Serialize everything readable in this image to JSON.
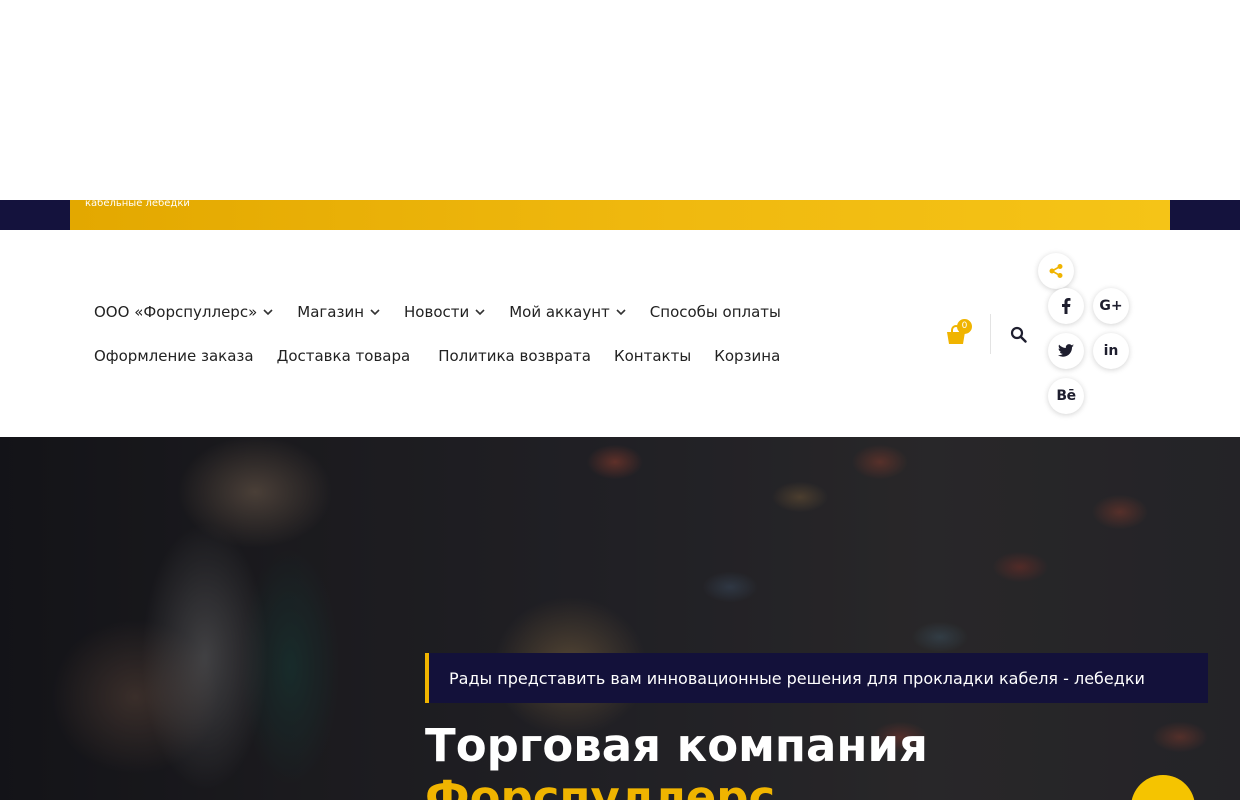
{
  "topbar": {
    "tagline": "кабельные лебедки"
  },
  "nav": {
    "row1": [
      {
        "label": "ООО «Форспуллерс»",
        "dropdown": true
      },
      {
        "label": "Магазин",
        "dropdown": true
      },
      {
        "label": "Новости",
        "dropdown": true
      },
      {
        "label": "Мой аккаунт",
        "dropdown": true
      },
      {
        "label": "Способы оплаты",
        "dropdown": false
      }
    ],
    "row2": [
      {
        "label": "Оформление заказа"
      },
      {
        "label": "Доставка товара"
      },
      {
        "label": "Политика возврата"
      },
      {
        "label": "Контакты"
      },
      {
        "label": "Корзина"
      }
    ]
  },
  "cart": {
    "count": "0",
    "icon": "shopping-bag-icon"
  },
  "search": {
    "icon": "search-icon"
  },
  "social": {
    "share_icon": "share-icon",
    "items": [
      "facebook-icon",
      "google-plus-icon",
      "twitter-icon",
      "linkedin-icon",
      "behance-icon"
    ],
    "google_plus_label": "G+",
    "behance_label": "Bē",
    "linkedin_label": "in"
  },
  "hero": {
    "badge": "Рады представить вам инновационные решения для прокладки кабеля - лебедки",
    "title_line1": "Торговая компания",
    "title_line2": "Форспуллерс"
  },
  "colors": {
    "accent": "#f0b400",
    "navy": "#13113a"
  }
}
